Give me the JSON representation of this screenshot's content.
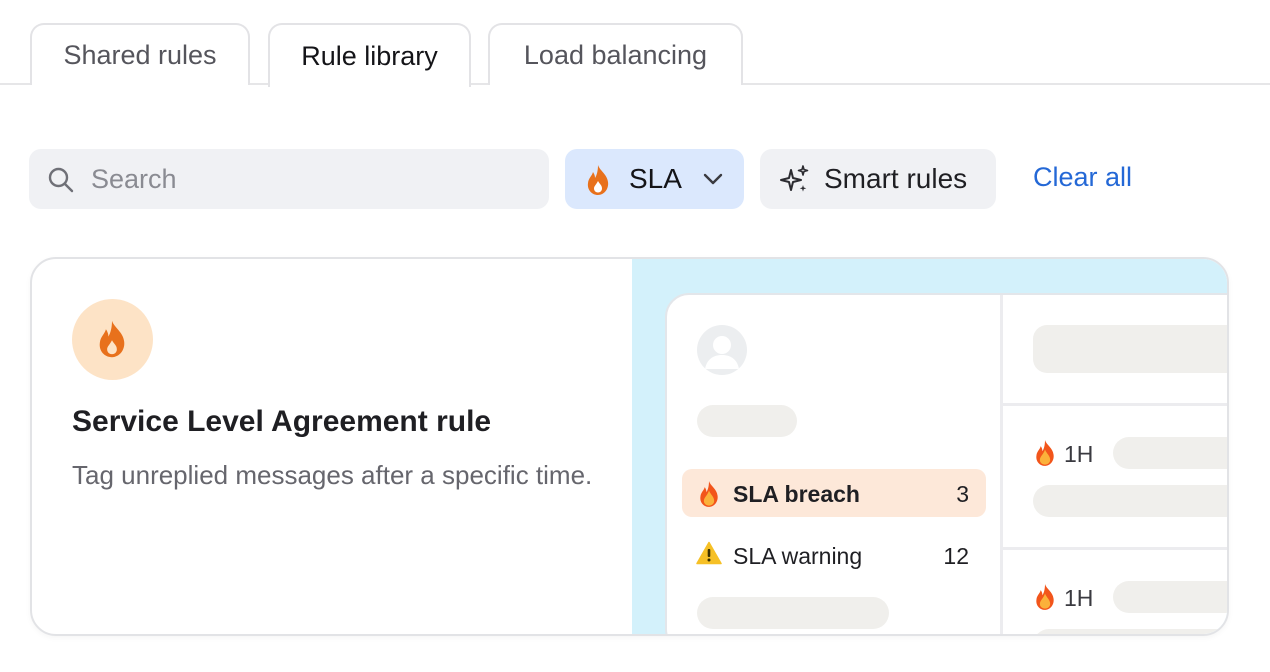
{
  "tabs": [
    {
      "label": "Shared rules",
      "active": false
    },
    {
      "label": "Rule library",
      "active": true
    },
    {
      "label": "Load balancing",
      "active": false
    }
  ],
  "filters": {
    "search_placeholder": "Search",
    "sla_chip_label": "SLA",
    "smart_chip_label": "Smart rules",
    "clear_all_label": "Clear all"
  },
  "card": {
    "title": "Service Level Agreement rule",
    "description": "Tag unreplied messages after a specific time.",
    "icon": "fire-icon"
  },
  "preview": {
    "rows": [
      {
        "icon": "fire-icon",
        "label": "SLA breach",
        "count": "3",
        "highlighted": true
      },
      {
        "icon": "warning-icon",
        "label": "SLA warning",
        "count": "12",
        "highlighted": false
      }
    ],
    "conversations": [
      {
        "icon": "fire-icon",
        "time": "1H"
      },
      {
        "icon": "fire-icon",
        "time": "1H"
      }
    ]
  },
  "colors": {
    "accent_blue": "#2468d6",
    "sla_chip_bg": "#dbe8fd",
    "fire_orange": "#e8711c",
    "icon_circle_bg": "#fde3c6",
    "preview_bg": "#d3f1fb",
    "breach_row_bg": "#fde8d9"
  }
}
